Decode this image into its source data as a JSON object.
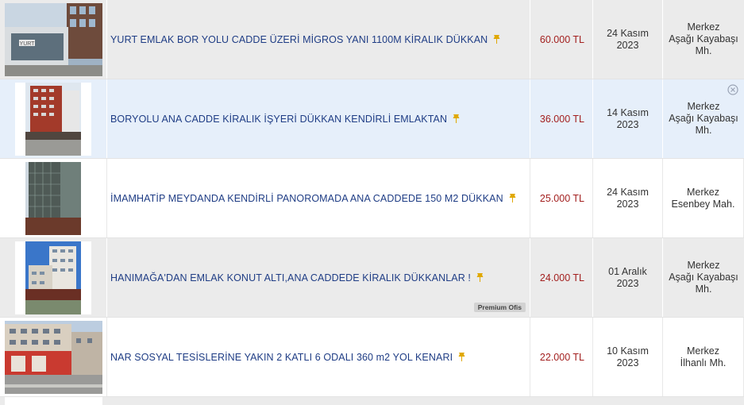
{
  "listings": [
    {
      "title": "YURT EMLAK BOR YOLU CADDE ÜZERİ MİGROS YANI 1100M KİRALIK DÜKKAN",
      "price": "60.000 TL",
      "date_day": "24 Kasım",
      "date_year": "2023",
      "loc_1": "Merkez",
      "loc_2": "Aşağı Kayabaşı",
      "loc_3": "Mh.",
      "thumb_sign": "YURT",
      "pin_icon": "pin-icon"
    },
    {
      "title": "BORYOLU ANA CADDE KİRALIK İŞYERİ DÜKKAN KENDİRLİ EMLAKTAN",
      "price": "36.000 TL",
      "date_day": "14 Kasım",
      "date_year": "2023",
      "loc_1": "Merkez",
      "loc_2": "Aşağı Kayabaşı",
      "loc_3": "Mh.",
      "pin_icon": "pin-icon",
      "close_icon": "close-icon"
    },
    {
      "title": "İMAMHATİP MEYDANDA KENDİRLİ PANOROMADA ANA CADDEDE 150 M2 DÜKKAN",
      "price": "25.000 TL",
      "date_day": "24 Kasım",
      "date_year": "2023",
      "loc_1": "Merkez",
      "loc_2": "Esenbey Mah.",
      "pin_icon": "pin-icon"
    },
    {
      "title": "HANIMAĞA'DAN EMLAK KONUT ALTI,ANA CADDEDE KİRALIK DÜKKANLAR !",
      "price": "24.000 TL",
      "date_day": "01 Aralık",
      "date_year": "2023",
      "loc_1": "Merkez",
      "loc_2": "Aşağı Kayabaşı",
      "loc_3": "Mh.",
      "badge": "Premium Ofis",
      "pin_icon": "pin-icon"
    },
    {
      "title": "NAR SOSYAL TESİSLERİNE YAKIN 2 KATLI 6 ODALI 360 m2 YOL KENARI",
      "price": "22.000 TL",
      "date_day": "10 Kasım",
      "date_year": "2023",
      "loc_1": "Merkez",
      "loc_2": "İlhanlı Mh.",
      "pin_icon": "pin-icon"
    }
  ],
  "colors": {
    "title": "#1f3d85",
    "price": "#a3201f",
    "shaded_row": "#ebebeb",
    "hover_row": "#e6effa"
  }
}
